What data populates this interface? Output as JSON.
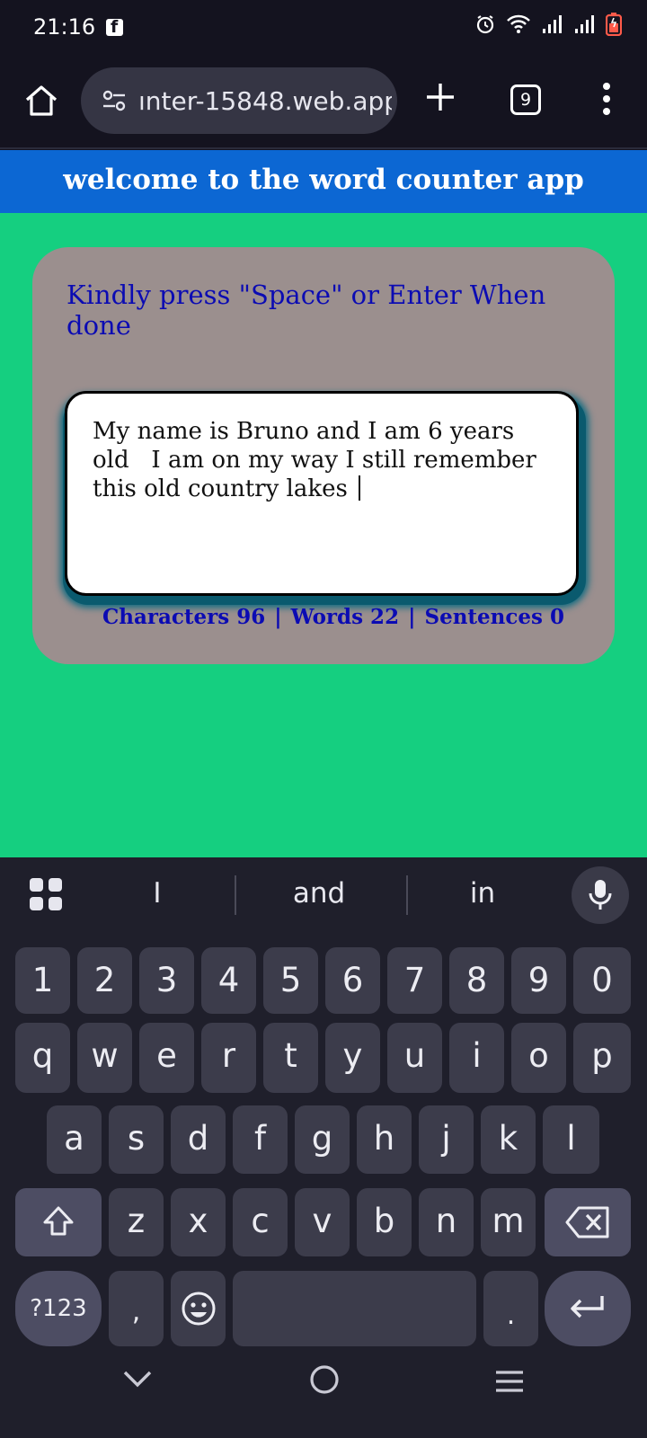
{
  "status_bar": {
    "time": "21:16",
    "icons": [
      "facebook-icon",
      "alarm-icon",
      "wifi-icon",
      "signal-icon",
      "signal-icon",
      "battery-icon"
    ]
  },
  "browser": {
    "url": "ınter-15848.web.app",
    "tab_count": "9"
  },
  "app": {
    "header": "welcome to the word counter app",
    "instruction": "Kindly press \"Space\" or Enter When done",
    "textarea_value": "My name is Bruno and I am 6 years old   I am on my way I still remember this old country lakes ",
    "counters": {
      "characters": "Characters 96",
      "sep1": "|",
      "words": "Words 22",
      "sep2": "|",
      "sentences": "Sentences 0"
    }
  },
  "keyboard": {
    "suggestions": [
      "I",
      "and",
      "in"
    ],
    "row_numbers": [
      "1",
      "2",
      "3",
      "4",
      "5",
      "6",
      "7",
      "8",
      "9",
      "0"
    ],
    "row_q": [
      "q",
      "w",
      "e",
      "r",
      "t",
      "y",
      "u",
      "i",
      "o",
      "p"
    ],
    "row_a": [
      "a",
      "s",
      "d",
      "f",
      "g",
      "h",
      "j",
      "k",
      "l"
    ],
    "row_z": [
      "z",
      "x",
      "c",
      "v",
      "b",
      "n",
      "m"
    ],
    "symbols_key": "?123",
    "comma_key": ",",
    "period_key": "."
  },
  "colors": {
    "page_bg": "#15cf80",
    "header_bg": "#0c67d3",
    "card_bg": "#9b8f8e",
    "text_blue": "#0b0bb3",
    "keyboard_bg": "#1f1f2b"
  }
}
